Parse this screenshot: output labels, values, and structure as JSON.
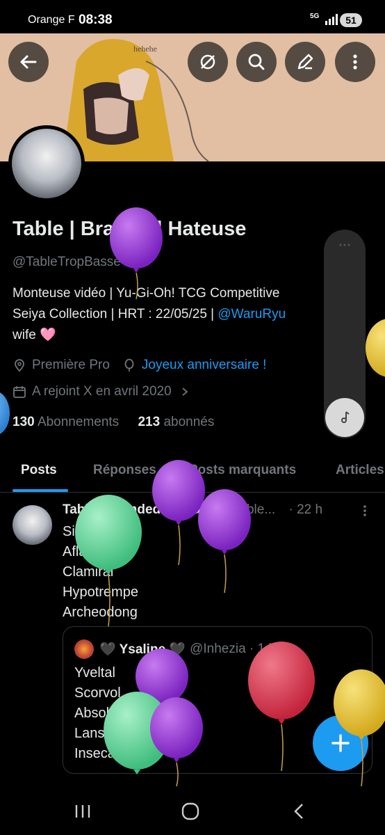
{
  "status_bar": {
    "carrier": "Orange F",
    "time": "08:38",
    "network": "5G",
    "battery": "51"
  },
  "header": {
    "icons": [
      "back-arrow-icon",
      "no-translate-icon",
      "search-icon",
      "edit-icon",
      "more-vertical-icon"
    ]
  },
  "profile": {
    "display_name": "Table | Branded Hateuse",
    "handle": "@TableTropBasse",
    "bio_line1": "Monteuse vidéo | Yu-Gi-Oh! TCG Competitive",
    "bio_line1_end": "t",
    "bio_line2": "Seiya Collection | HRT : 22/05/25 |",
    "bio_mention": "@WaruRyu",
    "bio_line3": "wife 🩷",
    "location": "Première Pro",
    "birthday": "Joyeux anniversaire !",
    "joined": "A rejoint X en avril 2020",
    "following_count": "130",
    "following_label": "Abonnements",
    "followers_count": "213",
    "followers_label": "abonnés"
  },
  "tabs": [
    {
      "label": "Posts",
      "active": true
    },
    {
      "label": "Réponses",
      "active": false
    },
    {
      "label": "Posts marquants",
      "active": false
    },
    {
      "label": "Articles",
      "active": false
    }
  ],
  "post": {
    "author": "Table | Branded Hateuse",
    "handle": "@Table...",
    "time": "· 22 h",
    "lines": [
      "Sinistrail",
      "Aflamanoir",
      "Clamiral",
      "Hypotrempe",
      "Archeodong"
    ],
    "quote": {
      "author": "🖤 Ysaline 🖤",
      "handle": "@Inhezia · 1 j",
      "lines": [
        "Yveltal",
        "Scorvol",
        "Absol",
        "Lanssorien",
        "Insecateur..."
      ]
    }
  },
  "fab_icon": "plus-icon",
  "colors": {
    "accent": "#1d9bf0",
    "background": "#000000",
    "text": "#e7e9ea",
    "dim": "#71767b",
    "balloon_purple": "#8b2fc9",
    "balloon_green": "#5fd39a",
    "balloon_red": "#d8334a",
    "balloon_yellow": "#e8c22f"
  },
  "nav_bar": {
    "icons": [
      "recent-apps-icon",
      "home-icon",
      "back-icon"
    ]
  }
}
